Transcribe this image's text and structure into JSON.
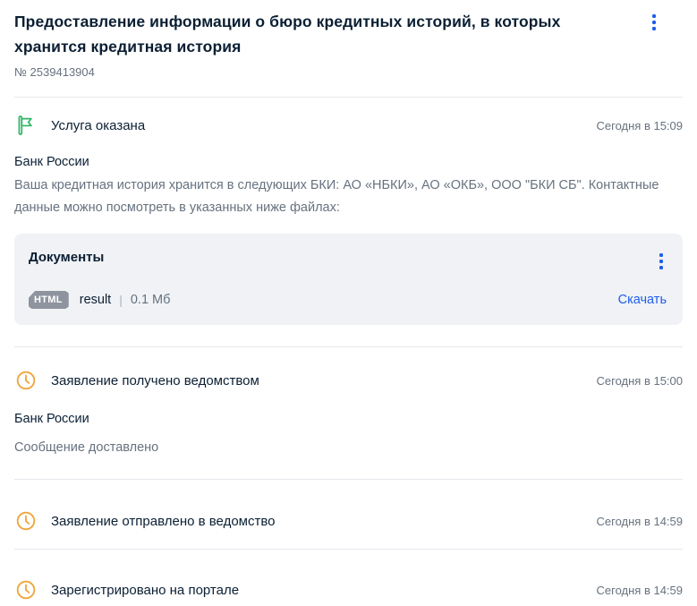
{
  "header": {
    "title": "Предоставление информации о бюро кредитных историй, в которых хранится кредитная история",
    "order_number": "№ 2539413904"
  },
  "colors": {
    "accent_blue": "#1d5deb",
    "success_green": "#31b668",
    "pending_yellow": "#efa63b",
    "text_dark": "#0b1f33",
    "text_gray": "#66727f",
    "card_background": "#f0f2f5",
    "badge_gray": "#8d949e",
    "divider": "#e4e8ed"
  },
  "events": [
    {
      "icon": "flag-icon",
      "title": "Услуга оказана",
      "time": "Сегодня в 15:09",
      "org": "Банк России",
      "message": "Ваша кредитная история хранится в следующих БКИ: АО «НБКИ», АО «ОКБ», ООО \"БКИ СБ\". Контактные данные можно посмотреть в указанных ниже файлах:",
      "documents": {
        "title": "Документы",
        "file": {
          "type_badge": "HTML",
          "name": "result",
          "separator": "|",
          "size": "0.1 Мб",
          "download_label": "Скачать"
        }
      }
    },
    {
      "icon": "clock-icon",
      "title": "Заявление получено ведомством",
      "time": "Сегодня в 15:00",
      "org": "Банк России",
      "message": "Сообщение доставлено"
    },
    {
      "icon": "clock-icon",
      "title": "Заявление отправлено в ведомство",
      "time": "Сегодня в 14:59"
    },
    {
      "icon": "clock-icon",
      "title": "Зарегистрировано на портале",
      "time": "Сегодня в 14:59"
    }
  ]
}
